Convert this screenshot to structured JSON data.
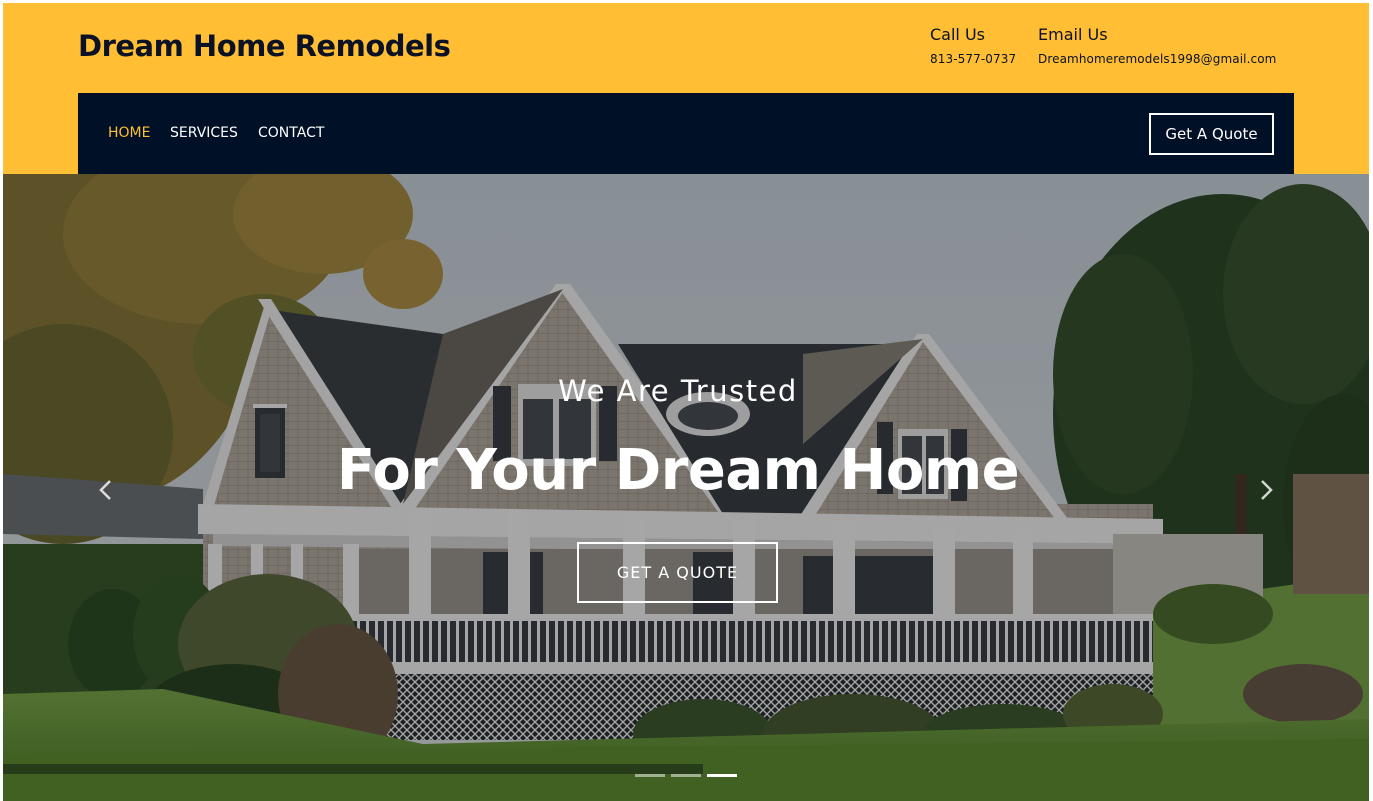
{
  "header": {
    "brand": "Dream Home Remodels",
    "call": {
      "title": "Call Us",
      "value": "813-577-0737"
    },
    "email": {
      "title": "Email Us",
      "value": "Dreamhomeremodels1998@gmail.com"
    }
  },
  "nav": {
    "items": [
      {
        "label": "HOME",
        "active": true
      },
      {
        "label": "SERVICES",
        "active": false
      },
      {
        "label": "CONTACT",
        "active": false
      }
    ],
    "quote_button": "Get A Quote"
  },
  "hero": {
    "kicker": "We Are Trusted",
    "title": "For Your Dream Home",
    "cta": "GET A QUOTE",
    "slides": {
      "count": 3,
      "active": 3
    }
  },
  "colors": {
    "accent": "#ffbe33",
    "navbar": "#001027",
    "text_dark": "#0b1226"
  },
  "icons": {
    "prev": "chevron-left-icon",
    "next": "chevron-right-icon"
  }
}
